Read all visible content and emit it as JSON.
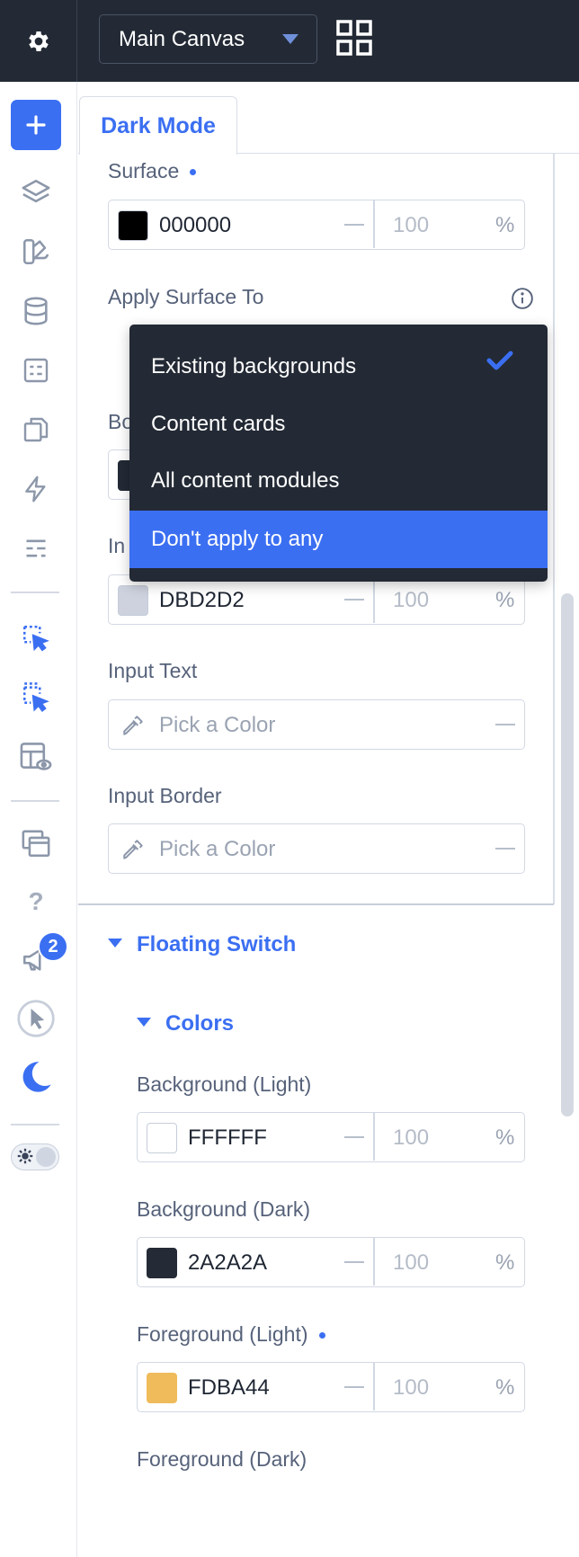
{
  "topbar": {
    "canvas_select_value": "Main Canvas",
    "icons": [
      "gear-icon",
      "chevron-down-icon",
      "grid-icon"
    ]
  },
  "rail": {
    "icons": [
      "plus-icon",
      "layers-icon",
      "palette-icon",
      "database-icon",
      "form-icon",
      "copy-icon",
      "lightning-icon",
      "sliders-icon",
      "select-pointer-icon",
      "multi-select-pointer-icon",
      "layout-preview-icon",
      "windows-icon",
      "help-icon",
      "megaphone-icon",
      "cursor-circle-icon",
      "moon-icon",
      "theme-toggle"
    ],
    "notification_badge": "2"
  },
  "panel": {
    "active_tab": "Dark Mode",
    "surface": {
      "label": "Surface",
      "hex": "000000",
      "opacity": "100",
      "pct": "%",
      "swatch_color": "#000000"
    },
    "apply_surface_to": {
      "label": "Apply Surface To",
      "options": [
        "Existing backgrounds",
        "Content cards",
        "All content modules",
        "Don't apply to any"
      ],
      "checked_option": "Existing backgrounds",
      "highlighted_option": "Don't apply to any"
    },
    "hidden_label_border": "Bo",
    "hidden_label_input": "In",
    "input_bg": {
      "hex": "DBD2D2",
      "opacity": "100",
      "pct": "%",
      "swatch_color": "#cdd2de"
    },
    "input_text": {
      "label": "Input Text",
      "placeholder": "Pick a Color"
    },
    "input_border": {
      "label": "Input Border",
      "placeholder": "Pick a Color"
    },
    "floating_switch": {
      "title": "Floating Switch",
      "colors_title": "Colors",
      "bg_light": {
        "label": "Background (Light)",
        "hex": "FFFFFF",
        "opacity": "100",
        "pct": "%",
        "swatch_color": "#ffffff"
      },
      "bg_dark": {
        "label": "Background (Dark)",
        "hex": "2A2A2A",
        "opacity": "100",
        "pct": "%",
        "swatch_color": "#252b36"
      },
      "fg_light": {
        "label": "Foreground (Light)",
        "hex": "FDBA44",
        "opacity": "100",
        "pct": "%",
        "swatch_color": "#f0bb5b"
      },
      "fg_dark": {
        "label": "Foreground (Dark)"
      }
    }
  },
  "colors": {
    "accent": "#3b6ff2",
    "topbar_bg": "#232a35",
    "menu_bg": "#232a35"
  }
}
